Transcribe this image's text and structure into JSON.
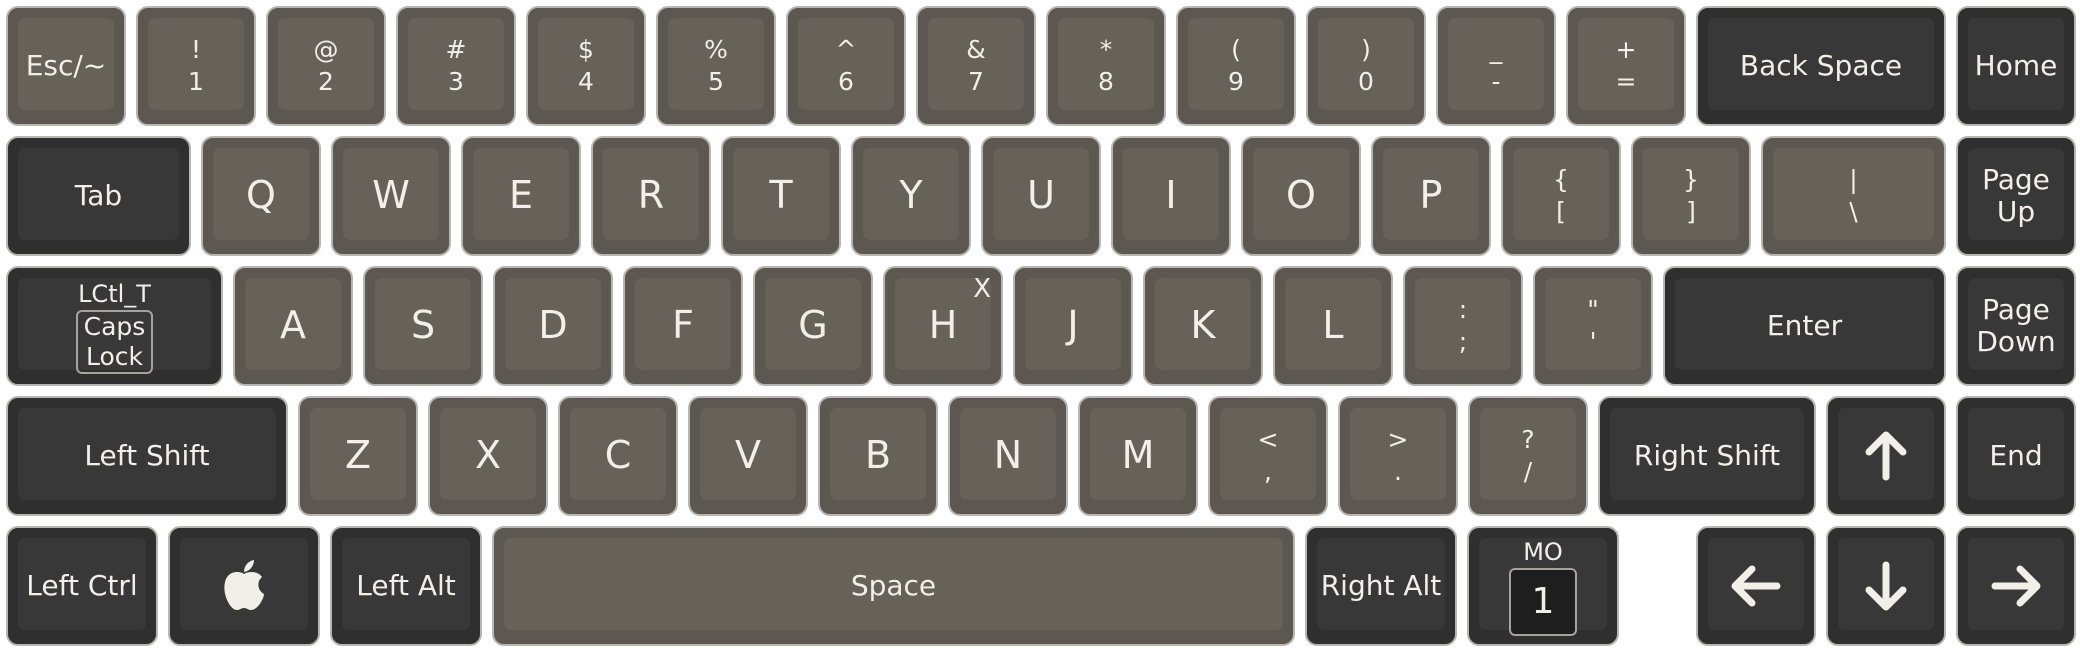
{
  "keyboard": {
    "row1": {
      "esc": "Esc/~",
      "k1": [
        "!",
        "1"
      ],
      "k2": [
        "@",
        "2"
      ],
      "k3": [
        "#",
        "3"
      ],
      "k4": [
        "$",
        "4"
      ],
      "k5": [
        "%",
        "5"
      ],
      "k6": [
        "^",
        "6"
      ],
      "k7": [
        "&",
        "7"
      ],
      "k8": [
        "*",
        "8"
      ],
      "k9": [
        "(",
        "9"
      ],
      "k0": [
        ")",
        "0"
      ],
      "minus": [
        "_",
        "-"
      ],
      "equals": [
        "+",
        "="
      ],
      "backspace": "Back Space",
      "home": "Home"
    },
    "row2": {
      "tab": "Tab",
      "q": "Q",
      "w": "W",
      "e": "E",
      "r": "R",
      "t": "T",
      "y": "Y",
      "u": "U",
      "i": "I",
      "o": "O",
      "p": "P",
      "lbracket": [
        "{",
        "["
      ],
      "rbracket": [
        "}",
        "]"
      ],
      "backslash": [
        "|",
        "\\"
      ],
      "pageup": [
        "Page",
        "Up"
      ]
    },
    "row3": {
      "capslock": {
        "top": "LCtl_T",
        "line1": "Caps",
        "line2": "Lock"
      },
      "a": "A",
      "s": "S",
      "d": "D",
      "f": "F",
      "g": "G",
      "h": "H",
      "h_corner": "X",
      "j": "J",
      "k": "K",
      "l": "L",
      "semicolon": [
        ":",
        ";"
      ],
      "quote": [
        "\"",
        "'"
      ],
      "enter": "Enter",
      "pagedown": [
        "Page",
        "Down"
      ]
    },
    "row4": {
      "lshift": "Left Shift",
      "z": "Z",
      "x": "X",
      "c": "C",
      "v": "V",
      "b": "B",
      "n": "N",
      "m": "M",
      "comma": [
        "<",
        ","
      ],
      "period": [
        ">",
        "."
      ],
      "slash": [
        "?",
        "/"
      ],
      "rshift": "Right Shift",
      "up": "up-arrow-icon",
      "end": "End"
    },
    "row5": {
      "lctrl": "Left Ctrl",
      "gui": "apple-icon",
      "lalt": "Left Alt",
      "space": "Space",
      "ralt": "Right Alt",
      "mo": {
        "top": "MO",
        "layer": "1"
      },
      "left": "left-arrow-icon",
      "down": "down-arrow-icon",
      "right": "right-arrow-icon"
    }
  },
  "colors": {
    "alpha_key": "#5c5851",
    "mod_key": "#2f2f2f",
    "legend": "#f2eee8"
  }
}
